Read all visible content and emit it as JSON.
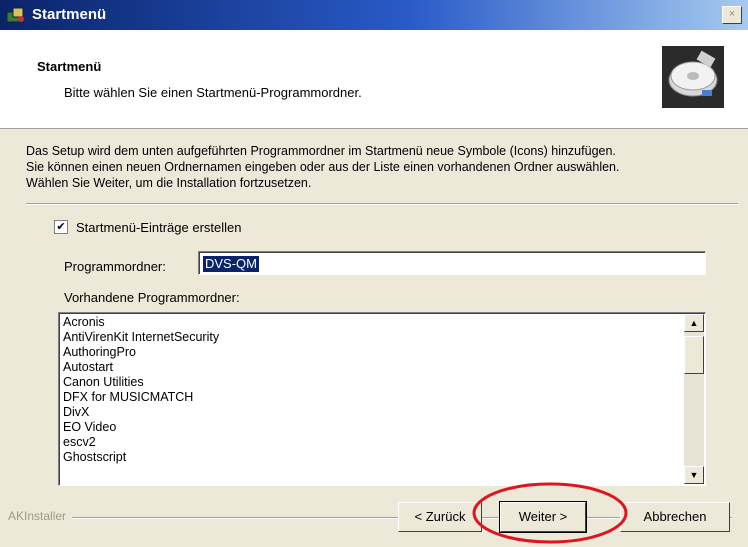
{
  "window": {
    "title": "Startmenü",
    "close_glyph": "×",
    "icon": "installer-icon"
  },
  "header": {
    "title": "Startmenü",
    "subtitle": "Bitte wählen Sie einen Startmenü-Programmordner.",
    "icon": "hard-disk-icon"
  },
  "description": {
    "lines": [
      "Das Setup wird dem unten aufgeführten Programmordner im Startmenü neue Symbole (Icons) hinzufügen.",
      "Sie können einen neuen Ordnernamen eingeben oder aus der Liste einen vorhandenen Ordner auswählen.",
      "Wählen Sie Weiter, um die Installation fortzusetzen."
    ]
  },
  "create_entries": {
    "label": "Startmenü-Einträge erstellen",
    "checked": true,
    "mark": "✔"
  },
  "program_folder": {
    "label": "Programmordner:",
    "value": "DVS-QM"
  },
  "existing_folders": {
    "label": "Vorhandene Programmordner:",
    "items": [
      "Acronis",
      "AntiVirenKit InternetSecurity",
      "AuthoringPro",
      "Autostart",
      "Canon Utilities",
      "DFX for MUSICMATCH",
      "DivX",
      "EO Video",
      "escv2",
      "Ghostscript"
    ],
    "scroll_up_glyph": "▲",
    "scroll_down_glyph": "▼"
  },
  "footer": {
    "brand": "AKInstaller",
    "back_label": "< Zurück",
    "next_label": "Weiter >",
    "cancel_label": "Abbrechen"
  },
  "colors": {
    "titlebar": "#0a246a",
    "selection": "#0a246a",
    "highlight": "#e0141e",
    "dialog_bg": "#ece9d8"
  }
}
